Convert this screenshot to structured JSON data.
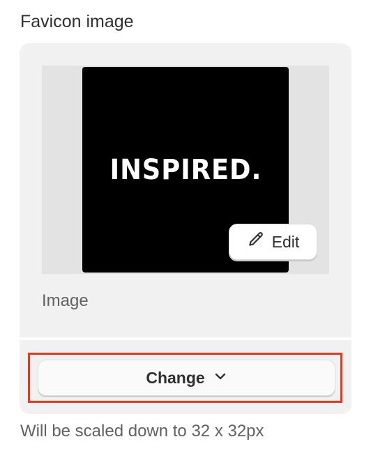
{
  "field": {
    "label": "Favicon image",
    "help_text": "Will be scaled down to 32 x 32px"
  },
  "preview": {
    "logo_text": "INSPIRED.",
    "edit_label": "Edit",
    "edit_icon": "pencil-icon",
    "caption": "Image"
  },
  "actions": {
    "change_label": "Change",
    "change_icon": "chevron-down-icon",
    "highlight_color": "#e5391c"
  }
}
